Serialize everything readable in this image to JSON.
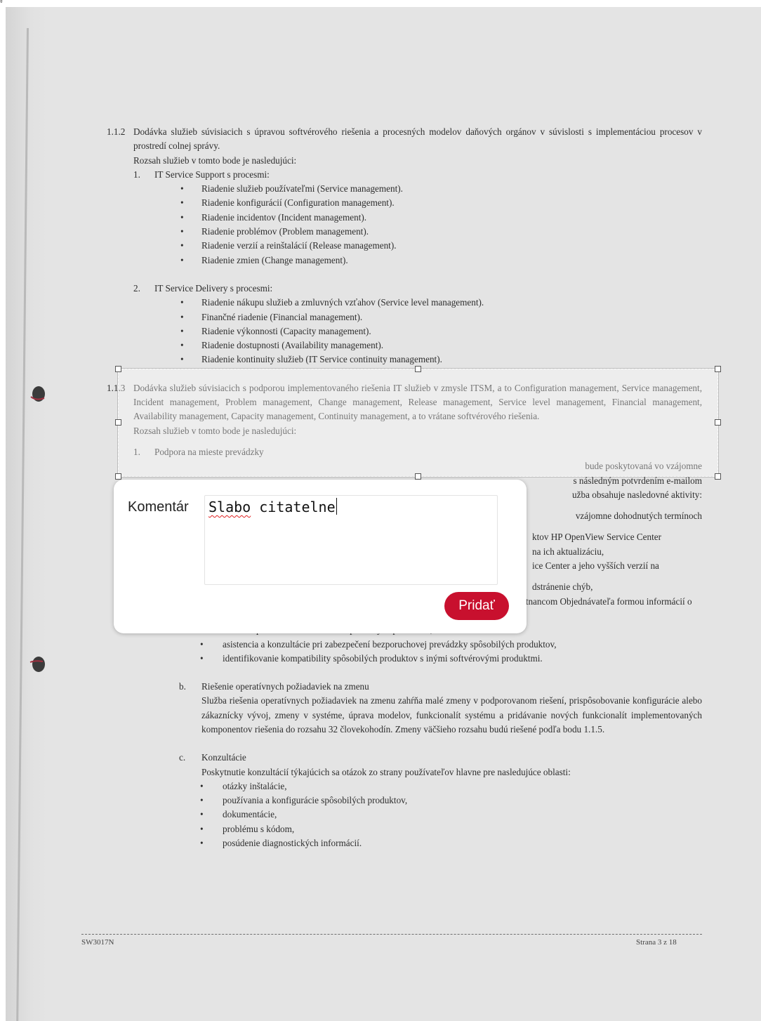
{
  "document": {
    "section_112": {
      "number": "1.1.2",
      "title": "Dodávka služieb súvisiacich s úpravou softvérového riešenia a procesných modelov daňových orgánov v súvislosti s implementáciou procesov v prostredí colnej správy.",
      "scope": "Rozsah služieb v tomto bode je nasledujúci:",
      "group1_num": "1.",
      "group1_title": "IT Service Support s procesmi:",
      "group1_items": [
        "Riadenie služieb používateľmi (Service management).",
        "Riadenie konfigurácií (Configuration management).",
        "Riadenie incidentov (Incident management).",
        "Riadenie problémov (Problem management).",
        "Riadenie verzií a reinštalácií (Release management).",
        "Riadenie zmien (Change management)."
      ],
      "group2_num": "2.",
      "group2_title": "IT Service Delivery s procesmi:",
      "group2_items": [
        "Riadenie nákupu služieb a zmluvných vzťahov (Service level management).",
        "Finančné riadenie (Financial management).",
        "Riadenie výkonnosti (Capacity management).",
        "Riadenie dostupnosti (Availability management).",
        "Riadenie kontinuity služieb (IT Service continuity management)."
      ]
    },
    "section_113": {
      "number": "1.1.3",
      "title": "Dodávka služieb súvisiacich s podporou implementovaného riešenia IT služieb v zmysle ITSM, a to Configuration management, Service management, Incident management, Problem management, Change management, Release management, Service level management, Financial management, Availability management, Capacity management, Continuity management, a to vrátane softvérového riešenia.",
      "scope": "Rozsah služieb v tomto bode je nasledujúci:",
      "item1_num": "1.",
      "item1_title": "Podpora na mieste prevádzky",
      "partial_lines": [
        "bude poskytovaná vo vzájomne",
        "s následným potvrdením e-mailom",
        "užba obsahuje nasledovné aktivity:",
        "vzájomne dohodnutých termínoch",
        "ktov HP OpenView Service Center",
        "na ich aktualizáciu,",
        "ice Center a jeho vyšších verzií na",
        "dstránenie chýb,"
      ],
      "bullets_a": [
        "sprostredkovanie prenosu vedomostí o zamestnanci spôsobilých produktov zamestnancom Objednávateľa formou informácií o postupoch pri zmenách konfigurácie,",
        "kontrolu prevedenia zálohovania spôsobilých produktov,",
        "asistencia a konzultácie pri zabezpečení bezporuchovej prevádzky spôsobilých produktov,",
        "identifikovanie kompatibility spôsobilých produktov s inými softvérovými produktmi."
      ],
      "sub_b_letter": "b.",
      "sub_b_title": "Riešenie operatívnych požiadaviek na zmenu",
      "sub_b_text": "Služba riešenia operatívnych požiadaviek na zmenu zahŕňa malé zmeny v podporovanom riešení, prispôsobovanie konfigurácie alebo zákaznícky vývoj, zmeny v systéme, úprava modelov, funkcionalít systému a pridávanie nových funkcionalít implementovaných komponentov riešenia do rozsahu 32 človekohodín. Zmeny väčšieho rozsahu budú riešené podľa bodu 1.1.5.",
      "sub_c_letter": "c.",
      "sub_c_title": "Konzultácie",
      "sub_c_text": "Poskytnutie konzultácií týkajúcich sa otázok zo strany používateľov hlavne pre nasledujúce oblasti:",
      "bullets_c": [
        "otázky inštalácie,",
        "používania a konfigurácie spôsobilých produktov,",
        "dokumentácie,",
        "problému s kódom,",
        "posúdenie diagnostických informácií."
      ]
    },
    "footer_left": "SW3017N",
    "footer_right": "Strana 3 z 18"
  },
  "comment_popup": {
    "label": "Komentár",
    "input_value": "Slabo citatelne",
    "misspelled_word": "Slabo",
    "rest_text": " citatelne",
    "add_button_label": "Pridať"
  },
  "colors": {
    "accent": "#c8102e",
    "scan_background": "#e4e4e4"
  }
}
